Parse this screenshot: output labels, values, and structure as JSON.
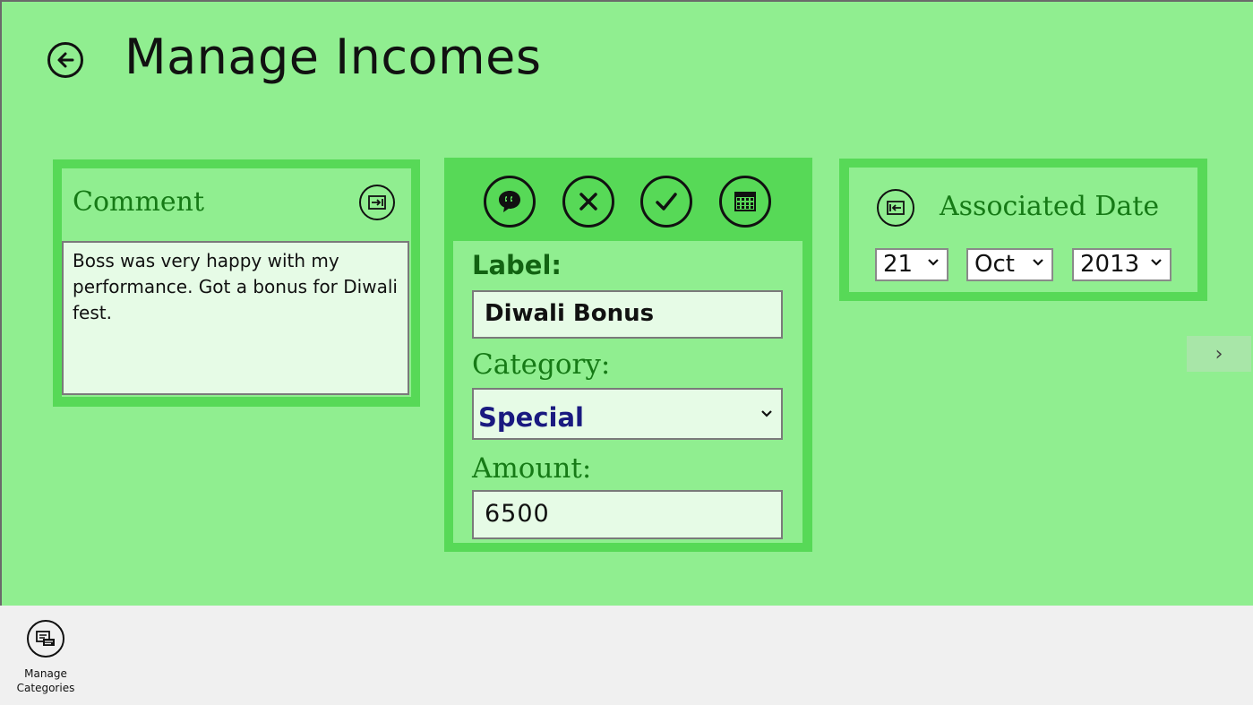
{
  "header": {
    "title": "Manage Incomes",
    "back_icon": "back-arrow-icon"
  },
  "comment_panel": {
    "heading": "Comment",
    "collapse_icon": "collapse-right-icon",
    "text": "Boss was very happy with my performance. Got a bonus for Diwali fest."
  },
  "entry_panel": {
    "action_icons": [
      "comment-bubble-icon",
      "cancel-icon",
      "accept-icon",
      "calendar-icon"
    ],
    "label_caption": "Label:",
    "label_value": "Diwali Bonus",
    "category_caption": "Category:",
    "category_value": "Special",
    "category_value_color": "#1a1a80",
    "amount_caption": "Amount:",
    "amount_value": "6500"
  },
  "date_panel": {
    "heading": "Associated Date",
    "collapse_icon": "collapse-left-icon",
    "day": "21",
    "month": "Oct",
    "year": "2013"
  },
  "navigation": {
    "next_glyph": "›"
  },
  "app_bar": {
    "button_label_line1": "Manage",
    "button_label_line2": "Categories",
    "button_icon": "manage-categories-icon"
  },
  "colors": {
    "background": "#90ee90",
    "panel_border": "#57d957",
    "heading": "#167a16",
    "field_bg": "#e6fbe6"
  }
}
